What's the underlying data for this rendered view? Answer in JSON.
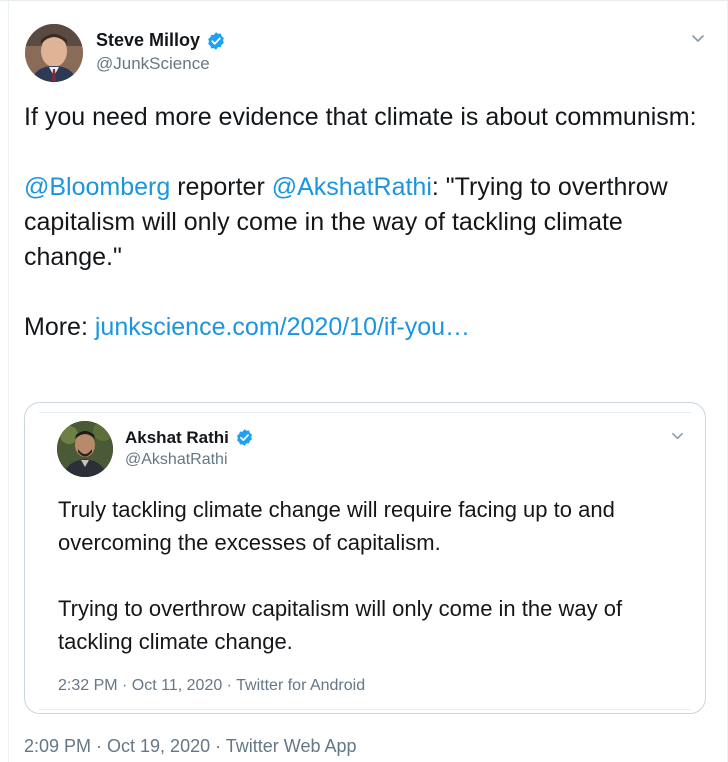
{
  "tweet": {
    "author_name": "Steve Milloy",
    "author_handle": "@JunkScience",
    "text_line1": "If you need more evidence that climate is about communism:",
    "mention_bloomberg": "@Bloomberg",
    "reporter_word": " reporter ",
    "mention_akshat": "@AkshatRathi",
    "quote_text": ": \"Trying to overthrow capitalism will only come in the way of tackling climate change.\"",
    "more_label": "More: ",
    "more_link": "junkscience.com/2020/10/if-you…",
    "timestamp": "2:09 PM · Oct 19, 2020 · Twitter Web App"
  },
  "quoted_tweet": {
    "author_name": "Akshat Rathi",
    "author_handle": "@AkshatRathi",
    "paragraph1": "Truly tackling climate change will require facing up to and overcoming the excesses of capitalism.",
    "paragraph2": "Trying to overthrow capitalism will only come in the way of tackling climate change.",
    "timestamp": "2:32 PM · Oct 11, 2020 · Twitter for Android"
  },
  "colors": {
    "link": "#1b95e0",
    "verified": "#1da1f2",
    "secondary_text": "#657786"
  },
  "icons": {
    "verified": "verified-badge-icon",
    "caret": "chevron-down-icon"
  }
}
